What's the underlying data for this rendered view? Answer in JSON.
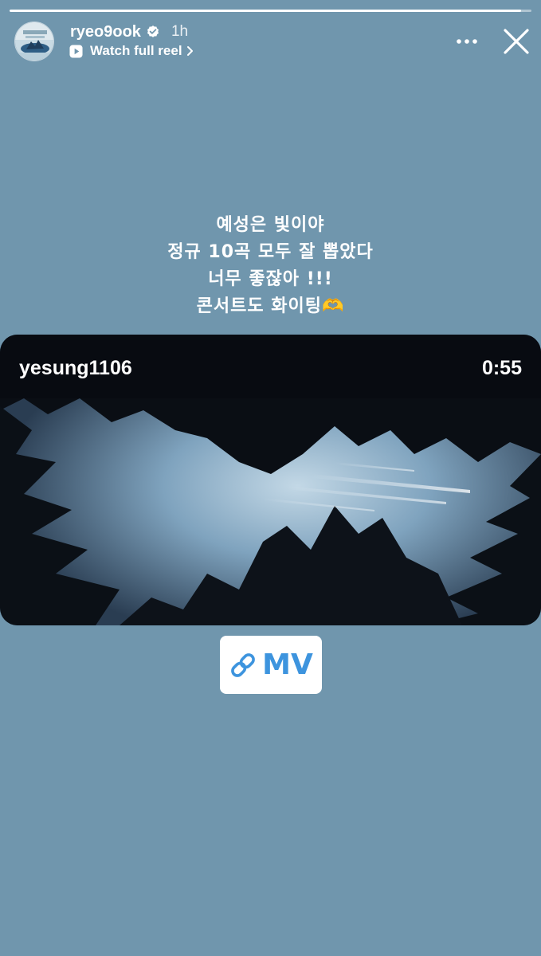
{
  "story": {
    "progress": 0.98,
    "accent_color": "#3d94de",
    "background_color": "#7096ad"
  },
  "header": {
    "username": "ryeo9ook",
    "verified": true,
    "timestamp": "1h",
    "watch_label": "Watch full reel",
    "icons": {
      "verified": "verified-badge-icon",
      "play": "play-icon",
      "chevron": "chevron-right-icon",
      "more": "more-options-icon",
      "close": "close-icon"
    }
  },
  "caption": {
    "lines": [
      "예성은 빛이야",
      "정규 10곡 모두 잘 뽑았다",
      "너무 좋잖아 !!!",
      "콘서트도 화이팅🫶"
    ]
  },
  "video": {
    "username": "yesung1106",
    "duration": "0:55"
  },
  "link_sticker": {
    "label": "MV",
    "icon": "link-icon"
  }
}
